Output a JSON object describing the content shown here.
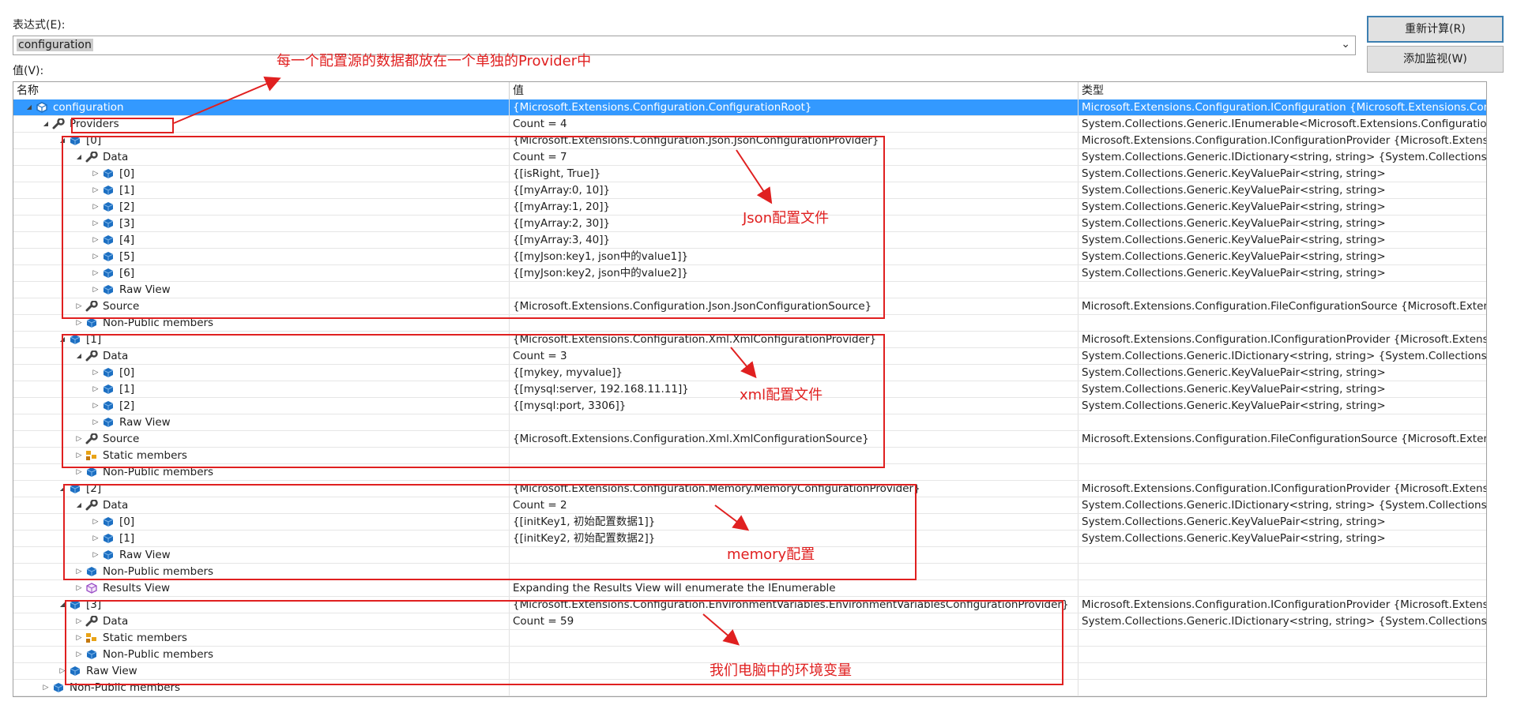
{
  "expression_label": "表达式(E):",
  "expression_value": "configuration",
  "value_label": "值(V):",
  "buttons": {
    "recalculate": "重新计算(R)",
    "add_watch": "添加监视(W)"
  },
  "columns": {
    "name": "名称",
    "value": "值",
    "type": "类型"
  },
  "rows": [
    {
      "level": 0,
      "exp": "expanded",
      "icon": "object",
      "name": "configuration",
      "value": "{Microsoft.Extensions.Configuration.ConfigurationRoot}",
      "type": "Microsoft.Extensions.Configuration.IConfiguration {Microsoft.Extensions.Con...",
      "selected": true
    },
    {
      "level": 1,
      "exp": "expanded",
      "icon": "wrench",
      "name": "Providers",
      "value": "Count = 4",
      "type": "System.Collections.Generic.IEnumerable<Microsoft.Extensions.Configuration..."
    },
    {
      "level": 2,
      "exp": "expanded",
      "icon": "field",
      "name": "[0]",
      "value": "{Microsoft.Extensions.Configuration.Json.JsonConfigurationProvider}",
      "type": "Microsoft.Extensions.Configuration.IConfigurationProvider {Microsoft.Extens..."
    },
    {
      "level": 3,
      "exp": "expanded",
      "icon": "wrench",
      "name": "Data",
      "value": "Count = 7",
      "type": "System.Collections.Generic.IDictionary<string, string> {System.Collections.G..."
    },
    {
      "level": 4,
      "exp": "collapsed",
      "icon": "field",
      "name": "[0]",
      "value": "{[isRight, True]}",
      "type": "System.Collections.Generic.KeyValuePair<string, string>"
    },
    {
      "level": 4,
      "exp": "collapsed",
      "icon": "field",
      "name": "[1]",
      "value": "{[myArray:0, 10]}",
      "type": "System.Collections.Generic.KeyValuePair<string, string>"
    },
    {
      "level": 4,
      "exp": "collapsed",
      "icon": "field",
      "name": "[2]",
      "value": "{[myArray:1, 20]}",
      "type": "System.Collections.Generic.KeyValuePair<string, string>"
    },
    {
      "level": 4,
      "exp": "collapsed",
      "icon": "field",
      "name": "[3]",
      "value": "{[myArray:2, 30]}",
      "type": "System.Collections.Generic.KeyValuePair<string, string>"
    },
    {
      "level": 4,
      "exp": "collapsed",
      "icon": "field",
      "name": "[4]",
      "value": "{[myArray:3, 40]}",
      "type": "System.Collections.Generic.KeyValuePair<string, string>"
    },
    {
      "level": 4,
      "exp": "collapsed",
      "icon": "field",
      "name": "[5]",
      "value": "{[myJson:key1, json中的value1]}",
      "type": "System.Collections.Generic.KeyValuePair<string, string>"
    },
    {
      "level": 4,
      "exp": "collapsed",
      "icon": "field",
      "name": "[6]",
      "value": "{[myJson:key2, json中的value2]}",
      "type": "System.Collections.Generic.KeyValuePair<string, string>"
    },
    {
      "level": 4,
      "exp": "collapsed",
      "icon": "field",
      "name": "Raw View",
      "value": "",
      "type": ""
    },
    {
      "level": 3,
      "exp": "collapsed",
      "icon": "wrench",
      "name": "Source",
      "value": "{Microsoft.Extensions.Configuration.Json.JsonConfigurationSource}",
      "type": "Microsoft.Extensions.Configuration.FileConfigurationSource {Microsoft.Exten..."
    },
    {
      "level": 3,
      "exp": "collapsed",
      "icon": "field",
      "name": "Non-Public members",
      "value": "",
      "type": ""
    },
    {
      "level": 2,
      "exp": "expanded",
      "icon": "field",
      "name": "[1]",
      "value": "{Microsoft.Extensions.Configuration.Xml.XmlConfigurationProvider}",
      "type": "Microsoft.Extensions.Configuration.IConfigurationProvider {Microsoft.Extens..."
    },
    {
      "level": 3,
      "exp": "expanded",
      "icon": "wrench",
      "name": "Data",
      "value": "Count = 3",
      "type": "System.Collections.Generic.IDictionary<string, string> {System.Collections.G..."
    },
    {
      "level": 4,
      "exp": "collapsed",
      "icon": "field",
      "name": "[0]",
      "value": "{[mykey, myvalue]}",
      "type": "System.Collections.Generic.KeyValuePair<string, string>"
    },
    {
      "level": 4,
      "exp": "collapsed",
      "icon": "field",
      "name": "[1]",
      "value": "{[mysql:server, 192.168.11.11]}",
      "type": "System.Collections.Generic.KeyValuePair<string, string>"
    },
    {
      "level": 4,
      "exp": "collapsed",
      "icon": "field",
      "name": "[2]",
      "value": "{[mysql:port, 3306]}",
      "type": "System.Collections.Generic.KeyValuePair<string, string>"
    },
    {
      "level": 4,
      "exp": "collapsed",
      "icon": "field",
      "name": "Raw View",
      "value": "",
      "type": ""
    },
    {
      "level": 3,
      "exp": "collapsed",
      "icon": "wrench",
      "name": "Source",
      "value": "{Microsoft.Extensions.Configuration.Xml.XmlConfigurationSource}",
      "type": "Microsoft.Extensions.Configuration.FileConfigurationSource {Microsoft.Exten..."
    },
    {
      "level": 3,
      "exp": "collapsed",
      "icon": "static",
      "name": "Static members",
      "value": "",
      "type": ""
    },
    {
      "level": 3,
      "exp": "collapsed",
      "icon": "field",
      "name": "Non-Public members",
      "value": "",
      "type": ""
    },
    {
      "level": 2,
      "exp": "expanded",
      "icon": "field",
      "name": "[2]",
      "value": "{Microsoft.Extensions.Configuration.Memory.MemoryConfigurationProvider}",
      "type": "Microsoft.Extensions.Configuration.IConfigurationProvider {Microsoft.Extens..."
    },
    {
      "level": 3,
      "exp": "expanded",
      "icon": "wrench",
      "name": "Data",
      "value": "Count = 2",
      "type": "System.Collections.Generic.IDictionary<string, string> {System.Collections.G..."
    },
    {
      "level": 4,
      "exp": "collapsed",
      "icon": "field",
      "name": "[0]",
      "value": "{[initKey1, 初始配置数据1]}",
      "type": "System.Collections.Generic.KeyValuePair<string, string>"
    },
    {
      "level": 4,
      "exp": "collapsed",
      "icon": "field",
      "name": "[1]",
      "value": "{[initKey2, 初始配置数据2]}",
      "type": "System.Collections.Generic.KeyValuePair<string, string>"
    },
    {
      "level": 4,
      "exp": "collapsed",
      "icon": "field",
      "name": "Raw View",
      "value": "",
      "type": ""
    },
    {
      "level": 3,
      "exp": "collapsed",
      "icon": "field",
      "name": "Non-Public members",
      "value": "",
      "type": ""
    },
    {
      "level": 3,
      "exp": "collapsed",
      "icon": "results",
      "name": "Results View",
      "value": "Expanding the Results View will enumerate the IEnumerable",
      "type": ""
    },
    {
      "level": 2,
      "exp": "expanded",
      "icon": "field",
      "name": "[3]",
      "value": "{Microsoft.Extensions.Configuration.EnvironmentVariables.EnvironmentVariablesConfigurationProvider}",
      "type": "Microsoft.Extensions.Configuration.IConfigurationProvider {Microsoft.Extens..."
    },
    {
      "level": 3,
      "exp": "collapsed",
      "icon": "wrench",
      "name": "Data",
      "value": "Count = 59",
      "type": "System.Collections.Generic.IDictionary<string, string> {System.Collections.G..."
    },
    {
      "level": 3,
      "exp": "collapsed",
      "icon": "static",
      "name": "Static members",
      "value": "",
      "type": ""
    },
    {
      "level": 3,
      "exp": "collapsed",
      "icon": "field",
      "name": "Non-Public members",
      "value": "",
      "type": ""
    },
    {
      "level": 2,
      "exp": "collapsed",
      "icon": "field",
      "name": "Raw View",
      "value": "",
      "type": ""
    },
    {
      "level": 1,
      "exp": "collapsed",
      "icon": "field",
      "name": "Non-Public members",
      "value": "",
      "type": ""
    }
  ],
  "annotations": {
    "provider_note": "每一个配置源的数据都放在一个单独的Provider中",
    "json": "Json配置文件",
    "xml": "xml配置文件",
    "memory": "memory配置",
    "env": "我们电脑中的环境变量"
  },
  "colors": {
    "annotation": "#e02020",
    "selection": "#3399ff",
    "icon_blue": "#1c6fc2"
  }
}
